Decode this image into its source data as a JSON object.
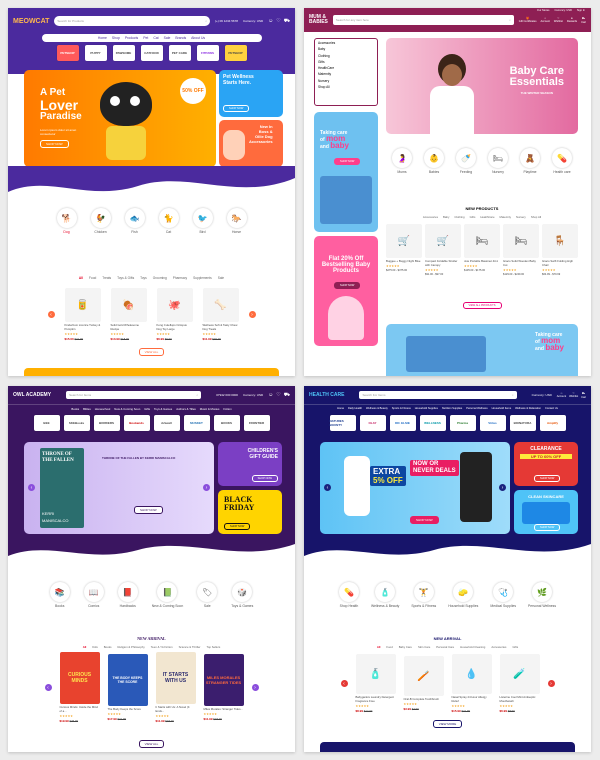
{
  "p1": {
    "logo": "MEOWCAT",
    "search_placeholder": "Search for Products",
    "phone": "(+) 06 1234 5678",
    "currency": "Currency: USD",
    "account": "Account",
    "wishlist": "Wishlist",
    "cart": "Cart",
    "nav": [
      "Home",
      "Shop",
      "Products",
      "Pet",
      "Cat",
      "Sale",
      "Brands",
      "About Us"
    ],
    "brands": [
      "PETSHOP",
      "PUPPY",
      "PAWSOME",
      "CATFOOD",
      "PET CARE",
      "FITPAWS",
      "PETSHOP"
    ],
    "banner": {
      "title1": "A Pet",
      "title2": "Lover",
      "title3": "Paradise",
      "sub": "Lorem ipsum dolor sit amet consectetur",
      "btn": "SHOP NOW",
      "badge": "50% OFF"
    },
    "side1": {
      "title1": "Pet Wellness",
      "title2": "Starts Here.",
      "btn": "SHOP NOW"
    },
    "side2": {
      "title1": "New In",
      "title2": "Boss &",
      "title3": "Ollie Dog",
      "title4": "Accessories",
      "btn": "SHOP NOW"
    },
    "cats": [
      "Dog",
      "Chicken",
      "Fish",
      "Cat",
      "Bird",
      "Horse"
    ],
    "tabs": [
      "All",
      "Food",
      "Treats",
      "Toys & Gifts",
      "Toys",
      "Grooming",
      "Pharmacy",
      "Supplements",
      "Sale"
    ],
    "products": [
      {
        "name": "Kinderbum Licorice Turkey & Pumpkin",
        "price": "$15.00",
        "old": "$21.00"
      },
      {
        "name": "Solid Gold Wholesome Recipe",
        "price": "$13.99",
        "old": "$18.00"
      },
      {
        "name": "Kong Cuteflops Octopus Dog Toy Large",
        "price": "$6.99",
        "old": "$9.99"
      },
      {
        "name": "Wellness Soft & Tasty Chew Dog Treats",
        "price": "$11.99",
        "old": "$15.00"
      }
    ],
    "view_all": "VIEW ALL"
  },
  "p2": {
    "logo1": "MUM &",
    "logo2": "BABIES",
    "search_placeholder": "Search for any item here",
    "top_links": [
      "Our Stores",
      "Currency: USD",
      "Sign In"
    ],
    "icons": [
      "Gift Certificates",
      "Account",
      "Wishlist",
      "Rewards",
      "Cart"
    ],
    "menu": [
      "Accessories",
      "Baby",
      "Clothing",
      "Gifts",
      "HealthCare",
      "Maternity",
      "Nursery",
      "Shop All"
    ],
    "hero": {
      "title1": "Baby Care",
      "title2": "Essentials",
      "sub": "THE WINTER SEASON"
    },
    "promo1": {
      "t1": "Taking care",
      "t2": "of",
      "t3": "mom",
      "t4": "and",
      "t5": "baby",
      "btn": "SHOP NOW"
    },
    "promo2": {
      "t1": "Flat 20% Off",
      "t2": "Bestselling Baby",
      "t3": "Products",
      "btn": "SHOP NOW"
    },
    "cats": [
      "Mums",
      "Babies",
      "Feeding",
      "Nursery",
      "Playtime",
      "Health care"
    ],
    "section": "NEW PRODUCTS",
    "tabs": [
      "Accessories",
      "Baby",
      "Clothing",
      "Gifts",
      "HealthCare",
      "Maternity",
      "Nursery",
      "Shop All"
    ],
    "products": [
      {
        "name": "Buggee + Buggy Night Blue",
        "price": "$275.00 - $375.00"
      },
      {
        "name": "Compact Foldable Stroller with Canopy",
        "price": "$91.00 - $97.00"
      },
      {
        "name": "Joie Portable Bassinet 4in1",
        "price": "$135.00 - $175.00"
      },
      {
        "name": "Graco Solid Wooden Baby Cot",
        "price": "$129.00 - $249.00"
      },
      {
        "name": "Graco Swift Folding High Chair",
        "price": "$64.99 - $79.99"
      }
    ],
    "view_all": "VIEW ALL PRODUCTS",
    "promo3": {
      "t1": "Taking care",
      "t2": "of",
      "t3": "mom",
      "t4": "and",
      "t5": "baby"
    }
  },
  "p3": {
    "logo": "OWL ACADEMY",
    "search_placeholder": "Search for Items",
    "phone": "07942 000 0000",
    "currency": "Currency: USD",
    "nav": [
      "Books",
      "Bibles",
      "Homeschool",
      "New & Coming Soon",
      "Gifts",
      "Toys & Games",
      "Authors & Titles",
      "Music & Movies",
      "Fiction"
    ],
    "brands": [
      "BEE",
      "SKEBooks",
      "BORDERS",
      "Bookends",
      "Arkwell",
      "MUSKET",
      "BOOKS",
      "FRONTIER"
    ],
    "hero": {
      "title1": "THRONE OF",
      "title2": "THE FALLEN",
      "author": "KERRI",
      "author2": "MANISCALCO",
      "heading": "THRONE OF THE FALLEN BY KERRI MANISCALCO",
      "btn": "SHOP NOW"
    },
    "side1": {
      "t1": "CHILDREN'S",
      "t2": "GIFT GUIDE",
      "btn": "SHOP NOW"
    },
    "side2": {
      "t1": "BLACK",
      "t2": "FRIDAY",
      "btn": "SHOP NOW"
    },
    "cats": [
      "Books",
      "Comics",
      "Hardbacks",
      "New & Coming Soon",
      "Sale",
      "Toys & Games"
    ],
    "section": "NEW ARRIVAL",
    "tabs": [
      "All",
      "Kids",
      "Books",
      "Religion & Philosophy",
      "Teen & YA Fiction",
      "Science & Thriller",
      "Top Sellers"
    ],
    "products": [
      {
        "title": "CURIOUS MINDS",
        "name": "Curious Minds: Inside the Mind of a...",
        "price": "$19.99",
        "old": "$25.00"
      },
      {
        "title": "THE BODY KEEPS THE SCORE",
        "name": "The Body Keeps the Score",
        "price": "$17.99",
        "old": "$21.00"
      },
      {
        "title": "IT STARTS WITH US",
        "name": "It Starts with Us: A Novel (It Ends...",
        "price": "$11.99",
        "old": "$18.00"
      },
      {
        "title": "MILES MORALES STRANGER TIDES",
        "name": "Miles Morales: Stranger Tides...",
        "price": "$11.99",
        "old": "$18.00"
      }
    ],
    "view_all": "VIEW ALL"
  },
  "p4": {
    "logo": "HEALTH CARE",
    "search_placeholder": "Search For Items",
    "currency": "Currency: USD",
    "icons": [
      "Account",
      "Wishlist",
      "Cart"
    ],
    "nav": [
      "Home",
      "Daily Health",
      "Wellness & Beauty",
      "Sports & Fitness",
      "Household Supplies",
      "Nutrition Supplies",
      "Personal Wellness",
      "Household Items",
      "Wellness & Relaxation",
      "Contact Us"
    ],
    "brands": [
      "NATURES BOUNTY",
      "OLAY",
      "DR. ELSIE",
      "WELLNESS",
      "Pharma",
      "Virtus",
      "BIONATURA",
      "Amplify"
    ],
    "hero": {
      "t1": "EXTRA",
      "t2": "5% OFF",
      "t3": "NOW OR",
      "t4": "NEVER DEALS",
      "btn": "SHOP NOW"
    },
    "side1": {
      "t1": "CLEARANCE",
      "t2": "UP TO 60% OFF",
      "btn": "SHOP NOW"
    },
    "side2": {
      "t1": "CLEAN SKINCARE",
      "btn": "SHOP NOW"
    },
    "cats": [
      "Shop Health",
      "Wellness & Beauty",
      "Sports & Fitness",
      "Household Supplies",
      "Medical Supplies",
      "Personal Wellness"
    ],
    "section": "NEW ARRIVAL",
    "tabs": [
      "All",
      "Food",
      "Baby Care",
      "Skin Care",
      "Personal Care",
      "Household Cleaning",
      "Accessories",
      "Gifts"
    ],
    "products": [
      {
        "name": "Babyganics Laundry Detergent Fragrance Free",
        "price": "$8.99",
        "old": "$12.00"
      },
      {
        "name": "Oral-B Complete Toothbrush",
        "price": "$3.99",
        "old": "$4.99"
      },
      {
        "name": "Nasal Spray 24 Hour Allergy Relief",
        "price": "$15.99",
        "old": "$21.99"
      },
      {
        "name": "Listerine Cool Mint Antiseptic Mouthwash",
        "price": "$6.99",
        "old": "$8.99"
      }
    ],
    "view_all": "VIEW MORE"
  }
}
